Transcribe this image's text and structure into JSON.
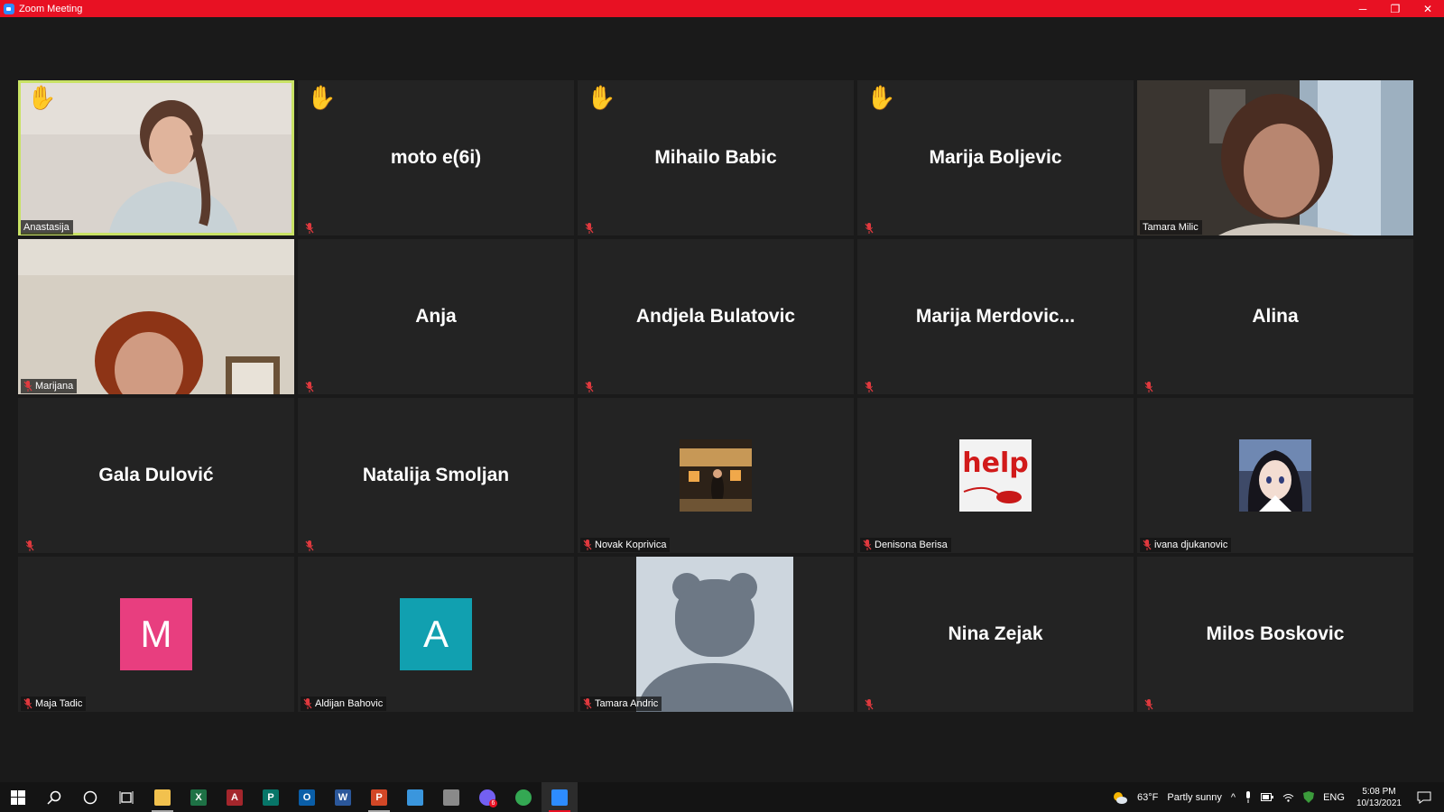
{
  "window": {
    "title": "Zoom Meeting",
    "minimize": "─",
    "restore": "❐",
    "close": "✕"
  },
  "tiles": [
    {
      "id": "anastasija",
      "label": "Anastasija",
      "type": "video",
      "hand": true,
      "active": true
    },
    {
      "id": "moto",
      "center_name": "moto e(6i)",
      "type": "name",
      "hand": true,
      "muted": true
    },
    {
      "id": "mihailo",
      "center_name": "Mihailo Babic",
      "type": "name",
      "hand": true,
      "muted": true
    },
    {
      "id": "marija-b",
      "center_name": "Marija Boljevic",
      "type": "name",
      "hand": true,
      "muted": true
    },
    {
      "id": "tamara-m",
      "label": "Tamara Milic",
      "type": "video"
    },
    {
      "id": "marijana",
      "label": "Marijana",
      "type": "video",
      "muted": true
    },
    {
      "id": "anja",
      "center_name": "Anja",
      "type": "name",
      "muted": true
    },
    {
      "id": "andjela",
      "center_name": "Andjela Bulatovic",
      "type": "name",
      "muted": true
    },
    {
      "id": "marija-m",
      "center_name": "Marija  Merdovic...",
      "type": "name",
      "muted": true
    },
    {
      "id": "alina",
      "center_name": "Alina",
      "type": "name",
      "muted": true
    },
    {
      "id": "gala",
      "center_name": "Gala Dulović",
      "type": "name",
      "muted": true
    },
    {
      "id": "natalija",
      "center_name": "Natalija Smoljan",
      "type": "name",
      "muted": true
    },
    {
      "id": "novak",
      "label": "Novak Koprivica",
      "type": "photo",
      "muted": true
    },
    {
      "id": "denisona",
      "label": "Denisona Berisa",
      "type": "help-photo",
      "photo_text": "help",
      "muted": true
    },
    {
      "id": "ivana",
      "label": "ivana djukanovic",
      "type": "anime-photo",
      "muted": true
    },
    {
      "id": "maja",
      "label": "Maja Tadic",
      "type": "letter",
      "letter": "M",
      "color": "#e83e7f",
      "muted": true
    },
    {
      "id": "aldijan",
      "label": "Aldijan Bahovic",
      "type": "letter",
      "letter": "A",
      "color": "#11a0b0",
      "muted": true
    },
    {
      "id": "tamara-a",
      "label": "Tamara Andric",
      "type": "bear",
      "muted": true
    },
    {
      "id": "nina",
      "center_name": "Nina Zejak",
      "type": "name",
      "muted": true
    },
    {
      "id": "milos",
      "center_name": "Milos Boskovic",
      "type": "name",
      "muted": true
    }
  ],
  "taskbar": {
    "apps": [
      {
        "name": "file-explorer",
        "glyph": "",
        "color": "#f2c14e",
        "running": true
      },
      {
        "name": "excel",
        "glyph": "X",
        "color": "#1e7145"
      },
      {
        "name": "access",
        "glyph": "A",
        "color": "#a4262c"
      },
      {
        "name": "publisher",
        "glyph": "P",
        "color": "#077568"
      },
      {
        "name": "outlook",
        "glyph": "O",
        "color": "#0a5ea8"
      },
      {
        "name": "word",
        "glyph": "W",
        "color": "#2b579a"
      },
      {
        "name": "powerpoint",
        "glyph": "P",
        "color": "#d24726",
        "running": true
      },
      {
        "name": "store",
        "glyph": "",
        "color": "#3a96dd"
      },
      {
        "name": "paint",
        "glyph": "",
        "color": "#8a8a8a"
      },
      {
        "name": "viber",
        "glyph": "",
        "color": "#7360f2",
        "badge": "6"
      },
      {
        "name": "chrome",
        "glyph": "",
        "color": "#34a853"
      },
      {
        "name": "zoom",
        "glyph": "",
        "color": "#2d8cff",
        "active": true
      }
    ],
    "weather_temp": "63°F",
    "weather_text": "Partly sunny",
    "language": "ENG",
    "time": "5:08 PM",
    "date": "10/13/2021"
  }
}
